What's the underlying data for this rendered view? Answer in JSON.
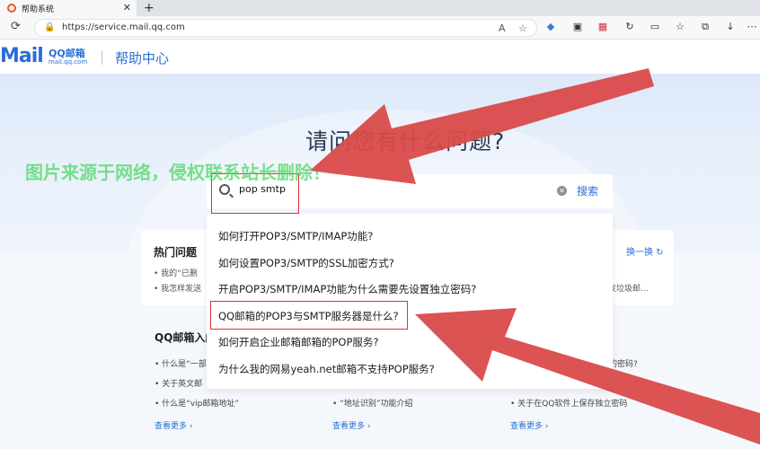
{
  "browser": {
    "tab_title": "帮助系统",
    "url": "https://service.mail.qq.com",
    "new_tab": "+"
  },
  "header": {
    "logo_main": "Mail",
    "logo_qq": "QQ邮箱",
    "logo_domain": "mail.qq.com",
    "title": "帮助中心"
  },
  "hero": {
    "title": "请问您有什么问题?",
    "watermark": "图片来源于网络，侵权联系站长删除！"
  },
  "search": {
    "value": "pop smtp",
    "button_label": "搜索"
  },
  "suggestions": [
    "如何打开POP3/SMTP/IMAP功能?",
    "如何设置POP3/SMTP的SSL加密方式?",
    "开启POP3/SMTP/IMAP功能为什么需要先设置独立密码?",
    "QQ邮箱的POP3与SMTP服务器是什么?",
    "如何开启企业邮箱邮箱的POP服务?",
    "为什么我的网易yeah.net邮箱不支持POP服务?"
  ],
  "hot": {
    "title": "热门问题",
    "refresh_label": "换一换",
    "lines": [
      "我的“已删",
      "我怎样发送"
    ],
    "right_line": "发垃圾邮..."
  },
  "intro": {
    "title": "QQ邮箱入门",
    "col1": [
      "什么是“一部",
      "关于英文邮",
      "什么是“vip邮箱地址”"
    ],
    "col2": [
      "“地址识别”功能介绍"
    ],
    "col3": [
      "的密码?",
      "关于在QQ软件上保存独立密码"
    ],
    "see_more": "查看更多 ›"
  },
  "colors": {
    "accent": "#2a6fd6",
    "annotation_red": "#d94a4a",
    "watermark_green": "#4dd764"
  }
}
